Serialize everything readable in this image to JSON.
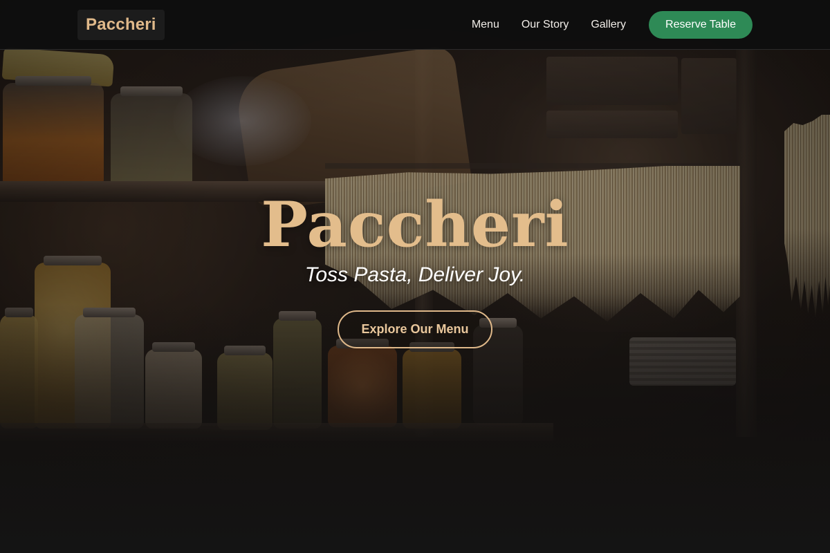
{
  "brand": {
    "logo_text": "Paccheri",
    "accent_color": "#e0b98a",
    "cta_color": "#2e8a56"
  },
  "nav": {
    "links": [
      {
        "label": "Menu"
      },
      {
        "label": "Our Story"
      },
      {
        "label": "Gallery"
      }
    ],
    "reserve_label": "Reserve Table"
  },
  "hero": {
    "title": "Paccheri",
    "tagline": "Toss Pasta, Deliver Joy.",
    "cta_label": "Explore Our Menu"
  }
}
